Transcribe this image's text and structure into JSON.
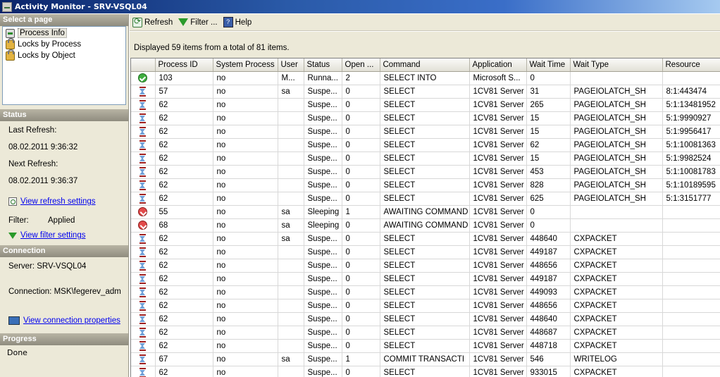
{
  "window": {
    "title": "Activity Monitor - SRV-VSQL04"
  },
  "sidebar": {
    "select_page_header": "Select a page",
    "pages": [
      {
        "label": "Process Info",
        "icon": "process-icon",
        "selected": true
      },
      {
        "label": "Locks by Process",
        "icon": "lock-icon",
        "selected": false
      },
      {
        "label": "Locks by Object",
        "icon": "lock-icon",
        "selected": false
      }
    ],
    "status_header": "Status",
    "last_refresh_label": "Last Refresh:",
    "last_refresh_value": "08.02.2011 9:36:32",
    "next_refresh_label": "Next Refresh:",
    "next_refresh_value": "08.02.2011 9:36:37",
    "view_refresh_link": "View refresh settings",
    "filter_label": "Filter:",
    "filter_value": "Applied",
    "view_filter_link": "View filter settings",
    "connection_header": "Connection",
    "server_text": "Server: SRV-VSQL04",
    "connection_text": "Connection: MSK\\fegerev_adm",
    "view_connection_link": "View connection properties",
    "progress_header": "Progress",
    "progress_text": "Done"
  },
  "toolbar": {
    "refresh_label": "Refresh",
    "filter_label": "Filter ...",
    "help_label": "Help"
  },
  "info": "Displayed 59 items from a total of 81 items.",
  "grid": {
    "columns": [
      "",
      "Process ID",
      "System Process",
      "User",
      "Status",
      "Open ...",
      "Command",
      "Application",
      "Wait Time",
      "Wait Type",
      "Resource"
    ],
    "rows": [
      [
        "running",
        "103",
        "no",
        "M...",
        "Runna...",
        "2",
        "SELECT INTO",
        "Microsoft S...",
        "0",
        "",
        ""
      ],
      [
        "suspended",
        "57",
        "no",
        "sa",
        "Suspe...",
        "0",
        "SELECT",
        "1CV81 Server",
        "31",
        "PAGEIOLATCH_SH",
        "8:1:443474"
      ],
      [
        "suspended",
        "62",
        "no",
        "",
        "Suspe...",
        "0",
        "SELECT",
        "1CV81 Server",
        "265",
        "PAGEIOLATCH_SH",
        "5:1:13481952"
      ],
      [
        "suspended",
        "62",
        "no",
        "",
        "Suspe...",
        "0",
        "SELECT",
        "1CV81 Server",
        "15",
        "PAGEIOLATCH_SH",
        "5:1:9990927"
      ],
      [
        "suspended",
        "62",
        "no",
        "",
        "Suspe...",
        "0",
        "SELECT",
        "1CV81 Server",
        "15",
        "PAGEIOLATCH_SH",
        "5:1:9956417"
      ],
      [
        "suspended",
        "62",
        "no",
        "",
        "Suspe...",
        "0",
        "SELECT",
        "1CV81 Server",
        "62",
        "PAGEIOLATCH_SH",
        "5:1:10081363"
      ],
      [
        "suspended",
        "62",
        "no",
        "",
        "Suspe...",
        "0",
        "SELECT",
        "1CV81 Server",
        "15",
        "PAGEIOLATCH_SH",
        "5:1:9982524"
      ],
      [
        "suspended",
        "62",
        "no",
        "",
        "Suspe...",
        "0",
        "SELECT",
        "1CV81 Server",
        "453",
        "PAGEIOLATCH_SH",
        "5:1:10081783"
      ],
      [
        "suspended",
        "62",
        "no",
        "",
        "Suspe...",
        "0",
        "SELECT",
        "1CV81 Server",
        "828",
        "PAGEIOLATCH_SH",
        "5:1:10189595"
      ],
      [
        "suspended",
        "62",
        "no",
        "",
        "Suspe...",
        "0",
        "SELECT",
        "1CV81 Server",
        "625",
        "PAGEIOLATCH_SH",
        "5:1:3151777"
      ],
      [
        "sleeping",
        "55",
        "no",
        "sa",
        "Sleeping",
        "1",
        "AWAITING COMMAND",
        "1CV81 Server",
        "0",
        "",
        ""
      ],
      [
        "sleeping",
        "68",
        "no",
        "sa",
        "Sleeping",
        "0",
        "AWAITING COMMAND",
        "1CV81 Server",
        "0",
        "",
        ""
      ],
      [
        "suspended",
        "62",
        "no",
        "sa",
        "Suspe...",
        "0",
        "SELECT",
        "1CV81 Server",
        "448640",
        "CXPACKET",
        ""
      ],
      [
        "suspended",
        "62",
        "no",
        "",
        "Suspe...",
        "0",
        "SELECT",
        "1CV81 Server",
        "449187",
        "CXPACKET",
        ""
      ],
      [
        "suspended",
        "62",
        "no",
        "",
        "Suspe...",
        "0",
        "SELECT",
        "1CV81 Server",
        "448656",
        "CXPACKET",
        ""
      ],
      [
        "suspended",
        "62",
        "no",
        "",
        "Suspe...",
        "0",
        "SELECT",
        "1CV81 Server",
        "449187",
        "CXPACKET",
        ""
      ],
      [
        "suspended",
        "62",
        "no",
        "",
        "Suspe...",
        "0",
        "SELECT",
        "1CV81 Server",
        "449093",
        "CXPACKET",
        ""
      ],
      [
        "suspended",
        "62",
        "no",
        "",
        "Suspe...",
        "0",
        "SELECT",
        "1CV81 Server",
        "448656",
        "CXPACKET",
        ""
      ],
      [
        "suspended",
        "62",
        "no",
        "",
        "Suspe...",
        "0",
        "SELECT",
        "1CV81 Server",
        "448640",
        "CXPACKET",
        ""
      ],
      [
        "suspended",
        "62",
        "no",
        "",
        "Suspe...",
        "0",
        "SELECT",
        "1CV81 Server",
        "448687",
        "CXPACKET",
        ""
      ],
      [
        "suspended",
        "62",
        "no",
        "",
        "Suspe...",
        "0",
        "SELECT",
        "1CV81 Server",
        "448718",
        "CXPACKET",
        ""
      ],
      [
        "suspended",
        "67",
        "no",
        "sa",
        "Suspe...",
        "1",
        "COMMIT TRANSACTI",
        "1CV81 Server",
        "546",
        "WRITELOG",
        ""
      ],
      [
        "suspended",
        "62",
        "no",
        "",
        "Suspe...",
        "0",
        "SELECT",
        "1CV81 Server",
        "933015",
        "CXPACKET",
        ""
      ]
    ]
  }
}
